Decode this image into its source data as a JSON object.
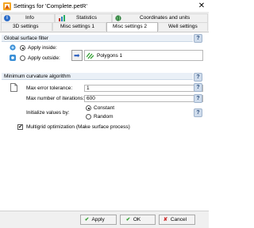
{
  "window": {
    "title": "Settings for 'Complete.petR'",
    "close_glyph": "✕"
  },
  "tabs": {
    "top": [
      {
        "label": "Info"
      },
      {
        "label": "Statistics"
      },
      {
        "label": "Coordinates and units"
      }
    ],
    "bottom": [
      {
        "label": "3D settings"
      },
      {
        "label": "Misc settings 1"
      },
      {
        "label": "Misc settings 2",
        "active": true
      },
      {
        "label": "Well settings"
      }
    ]
  },
  "global_filter": {
    "title": "Global surface filter",
    "apply_inside": {
      "label": "Apply inside:",
      "selected": true
    },
    "apply_outside": {
      "label": "Apply outside:",
      "selected": false
    },
    "polygon": {
      "value": "Polygons 1"
    }
  },
  "min_curvature": {
    "title": "Minimum curvature algorithm",
    "max_error": {
      "label": "Max error tolerance:",
      "value": "1"
    },
    "max_iterations": {
      "label": "Max number of iterations:",
      "value": "600"
    },
    "initialize": {
      "label": "Initialize values by:",
      "options": [
        {
          "label": "Constant",
          "selected": true
        },
        {
          "label": "Random",
          "selected": false
        }
      ]
    },
    "multigrid": {
      "label": "Multigrid optimization (Make surface process)",
      "checked": true
    }
  },
  "footer": {
    "apply": "Apply",
    "ok": "OK",
    "cancel": "Cancel"
  },
  "icons": {
    "help_glyph": "?",
    "check_glyph": "✔",
    "cancel_glyph": "✘",
    "arrow_glyph": "➡"
  },
  "colors": {
    "group_header_bg": "#eaf0f7",
    "accent_green": "#2e9e2e",
    "accent_red": "#cc2b2b",
    "arrow_blue": "#2b5fbf"
  }
}
